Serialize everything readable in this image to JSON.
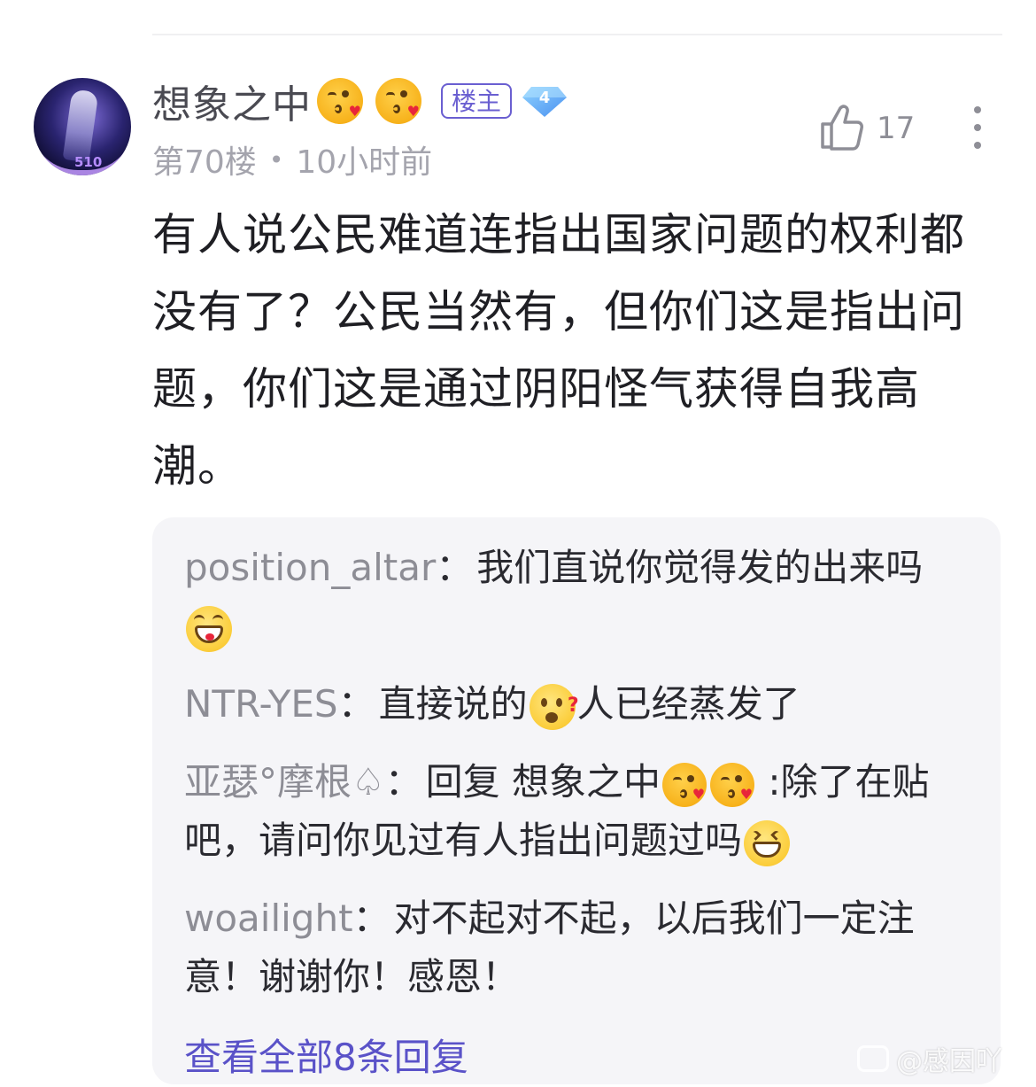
{
  "post": {
    "username": "想象之中",
    "user_emojis": [
      "kiss-face-emoji",
      "kiss-face-emoji"
    ],
    "host_badge": "楼主",
    "user_level": "4",
    "avatar_level_text": "510",
    "floor": "第70楼",
    "meta_separator": "•",
    "time_ago": "10小时前",
    "like_count": "17",
    "content": "有人说公民难道连指出国家问题的权利都没有了？公民当然有，但你们这是指出问题，你们这是通过阴阳怪气获得自我高潮。"
  },
  "replies": [
    {
      "author": "position_altar",
      "text_before": "我们直说你觉得发的出来吗",
      "emoji_after": "grin-emoji"
    },
    {
      "author": "NTR-YES",
      "text_before": "直接说的",
      "emoji_mid": "thinking-emoji",
      "text_after": "人已经蒸发了"
    },
    {
      "author": "亚瑟°摩根♤",
      "text_before": "回复 想象之中",
      "text_after": " :除了在贴吧，请问你见过有人指出问题过吗"
    },
    {
      "author": "woailight",
      "text_before": "对不起对不起，以后我们一定注意！谢谢你！感恩！"
    }
  ],
  "colon": "：",
  "view_all_replies": "查看全部8条回复",
  "watermark": "@感因吖",
  "colors": {
    "accent": "#5a52c8",
    "host_badge": "#6a5fd1",
    "reply_bg": "#f5f5f8",
    "meta_gray": "#a4a4ad"
  }
}
